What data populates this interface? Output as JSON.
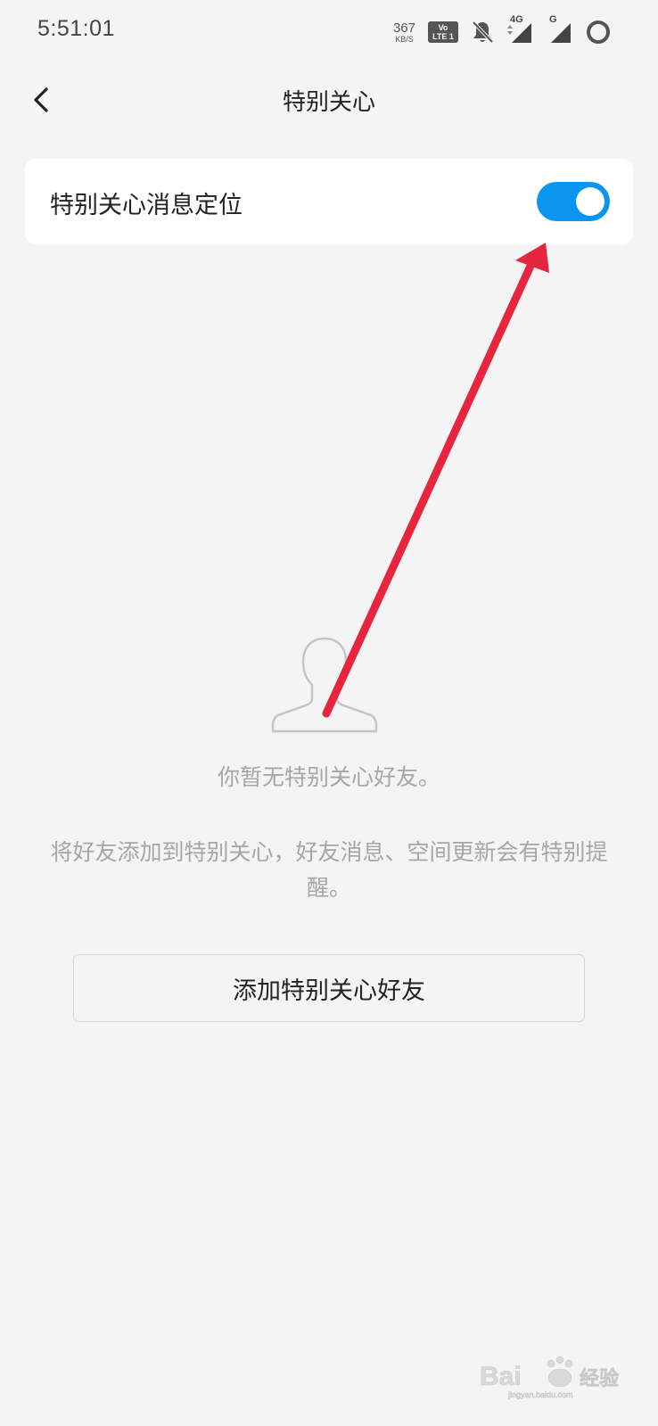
{
  "status_bar": {
    "time": "5:51:01",
    "net_speed_value": "367",
    "net_speed_unit": "KB/S",
    "volte_line1": "Vo",
    "volte_line2": "LTE",
    "volte_sim": "1",
    "signal1_label": "4G",
    "signal2_label": "G"
  },
  "header": {
    "title": "特别关心",
    "back_icon": "chevron-left-icon"
  },
  "setting": {
    "label": "特别关心消息定位",
    "toggle_on": true,
    "toggle_color": "#0a96f0"
  },
  "empty_state": {
    "avatar_icon": "person-outline-icon",
    "title": "你暂无特别关心好友。",
    "description": "将好友添加到特别关心，好友消息、空间更新会有特别提醒。"
  },
  "add_button": {
    "label": "添加特别关心好友"
  },
  "annotation": {
    "color": "#e8253f"
  },
  "colors": {
    "background": "#f4f4f4",
    "card": "#ffffff",
    "muted_text": "#a6a6a6"
  }
}
